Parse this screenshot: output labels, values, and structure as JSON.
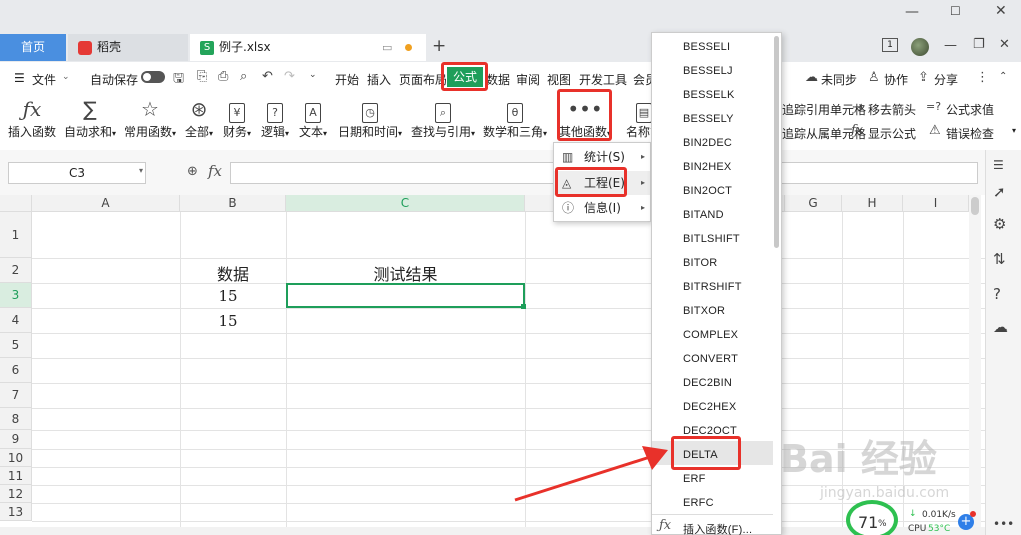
{
  "titlebar": {
    "home_tab": "首页",
    "daoke_tab": "稻壳",
    "file_tab": "例子.xlsx",
    "new_tab": "+",
    "minimize": "—",
    "maximize": "☐",
    "close": "✕",
    "window_count": "1"
  },
  "menubar": {
    "file_menu": "文件",
    "autosave": "自动保存",
    "tabs": [
      "开始",
      "插入",
      "页面布局",
      "公式",
      "数据",
      "审阅",
      "视图",
      "开发工具",
      "会员"
    ],
    "active_tab": "公式",
    "sync": "未同步",
    "collab": "协作",
    "share": "分享"
  },
  "ribbon": {
    "buttons": [
      "插入函数",
      "自动求和",
      "常用函数",
      "全部",
      "财务",
      "逻辑",
      "文本",
      "日期和时间",
      "查找与引用",
      "数学和三角",
      "其他函数",
      "名称管"
    ],
    "right_commands": [
      "追踪引用单元格",
      "移去箭头",
      "公式求值",
      "追踪从属单元格",
      "显示公式",
      "错误检查"
    ]
  },
  "formula_bar": {
    "name_box": "C3",
    "fx": "fx",
    "value": ""
  },
  "grid": {
    "columns": [
      "A",
      "B",
      "C",
      "",
      "G",
      "H",
      "I"
    ],
    "rows": [
      "1",
      "2",
      "3",
      "4",
      "5",
      "6",
      "7",
      "8",
      "9",
      "10",
      "11",
      "12",
      "13"
    ],
    "cells": {
      "B2": "数据",
      "C2": "测试结果",
      "B3": "15",
      "B4": "15"
    },
    "selected_cell": "C3"
  },
  "submenu": {
    "items": [
      "统计(S)",
      "工程(E)",
      "信息(I)"
    ]
  },
  "function_list": {
    "items": [
      "BESSELI",
      "BESSELJ",
      "BESSELK",
      "BESSELY",
      "BIN2DEC",
      "BIN2HEX",
      "BIN2OCT",
      "BITAND",
      "BITLSHIFT",
      "BITOR",
      "BITRSHIFT",
      "BITXOR",
      "COMPLEX",
      "CONVERT",
      "DEC2BIN",
      "DEC2HEX",
      "DEC2OCT",
      "DELTA",
      "ERF",
      "ERFC"
    ],
    "highlighted": "DELTA",
    "footer": "插入函数(F)..."
  },
  "status": {
    "cpu_percent": "71",
    "percent_sign": "%",
    "net_speed": "0.01K/s",
    "cpu_temp_label": "CPU",
    "cpu_temp": "53°C"
  },
  "watermark": {
    "text": "Bai 经验",
    "url": "jingyan.baidu.com"
  },
  "colors": {
    "accent_green": "#1e9e5a",
    "highlight_red": "#e8312a",
    "home_blue": "#4a8fe0"
  }
}
